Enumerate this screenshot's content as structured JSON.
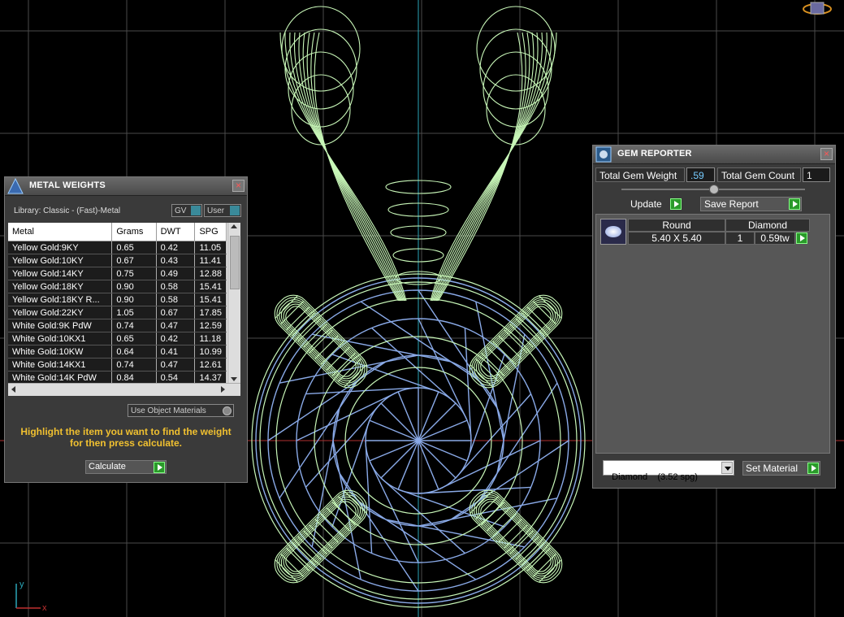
{
  "metal_weights": {
    "title": "METAL WEIGHTS",
    "library": "Library: Classic - (Fast)-Metal",
    "gv_label": "GV",
    "user_label": "User",
    "columns": [
      "Metal",
      "Grams",
      "DWT",
      "SPG"
    ],
    "rows": [
      [
        "Yellow Gold:9KY",
        "0.65",
        "0.42",
        "11.05"
      ],
      [
        "Yellow Gold:10KY",
        "0.67",
        "0.43",
        "11.41"
      ],
      [
        "Yellow Gold:14KY",
        "0.75",
        "0.49",
        "12.88"
      ],
      [
        "Yellow Gold:18KY",
        "0.90",
        "0.58",
        "15.41"
      ],
      [
        "Yellow Gold:18KY R...",
        "0.90",
        "0.58",
        "15.41"
      ],
      [
        "Yellow Gold:22KY",
        "1.05",
        "0.67",
        "17.85"
      ],
      [
        "White Gold:9K PdW",
        "0.74",
        "0.47",
        "12.59"
      ],
      [
        "White Gold:10KX1",
        "0.65",
        "0.42",
        "11.18"
      ],
      [
        "White Gold:10KW",
        "0.64",
        "0.41",
        "10.99"
      ],
      [
        "White Gold:14KX1",
        "0.74",
        "0.47",
        "12.61"
      ],
      [
        "White Gold:14K PdW",
        "0.84",
        "0.54",
        "14.37"
      ]
    ],
    "use_object_materials": "Use Object Materials",
    "instruction": "Highlight the item you want to find the weight for then press calculate.",
    "calculate": "Calculate"
  },
  "gem_reporter": {
    "title": "GEM REPORTER",
    "total_weight_label": "Total Gem Weight",
    "total_weight_value": ".59",
    "total_count_label": "Total Gem Count",
    "total_count_value": "1",
    "update": "Update",
    "save_report": "Save Report",
    "gem": {
      "shape": "Round",
      "size": "5.40 X 5.40",
      "material": "Diamond",
      "count": "1",
      "weight": "0.59tw"
    },
    "material_select": "Diamond    (3.52 spg)",
    "set_material": "Set Material"
  },
  "axis": {
    "y": "y",
    "x": "x"
  },
  "colors": {
    "wire_green": "#c8f7b8",
    "wire_blue": "#8aaae8",
    "grid": "#4a4a4a",
    "axis_cyan": "#2aa6b8"
  }
}
